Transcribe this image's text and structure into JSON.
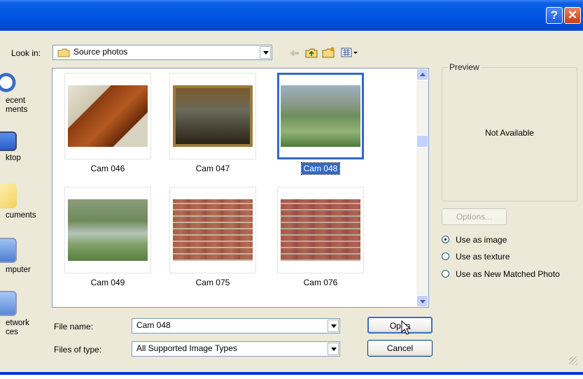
{
  "window": {
    "help_glyph": "?",
    "close_glyph": "✕"
  },
  "look_in": {
    "label": "Look in:",
    "value": "Source photos"
  },
  "toolbar": {
    "icons": [
      "back-icon",
      "up-folder-icon",
      "new-folder-icon",
      "views-menu-icon"
    ]
  },
  "places": [
    {
      "name": "recent",
      "label": "ecent\nments",
      "icon": "recent-documents-icon"
    },
    {
      "name": "desktop",
      "label": "ktop",
      "icon": "desktop-icon"
    },
    {
      "name": "documents",
      "label": "cuments",
      "icon": "my-documents-icon"
    },
    {
      "name": "computer",
      "label": "mputer",
      "icon": "my-computer-icon"
    },
    {
      "name": "network",
      "label": "etwork\nces",
      "icon": "network-places-icon"
    }
  ],
  "files": [
    {
      "name": "Cam 046",
      "selected": false
    },
    {
      "name": "Cam 047",
      "selected": false
    },
    {
      "name": "Cam 048",
      "selected": true
    },
    {
      "name": "Cam 049",
      "selected": false
    },
    {
      "name": "Cam 075",
      "selected": false
    },
    {
      "name": "Cam 076",
      "selected": false
    }
  ],
  "file_name": {
    "label": "File name:",
    "value": "Cam 048"
  },
  "file_type": {
    "label": "Files of type:",
    "value": "All Supported Image Types"
  },
  "buttons": {
    "open": "Open",
    "cancel": "Cancel",
    "options": "Options..."
  },
  "preview": {
    "title": "Preview",
    "text": "Not Available"
  },
  "import_mode": {
    "options": [
      "Use as image",
      "Use as texture",
      "Use as New Matched Photo"
    ],
    "selected": "Use as image"
  },
  "colors": {
    "title_bar": "#0054e3",
    "dialog_bg": "#ece9d8",
    "selection": "#316ac5"
  }
}
